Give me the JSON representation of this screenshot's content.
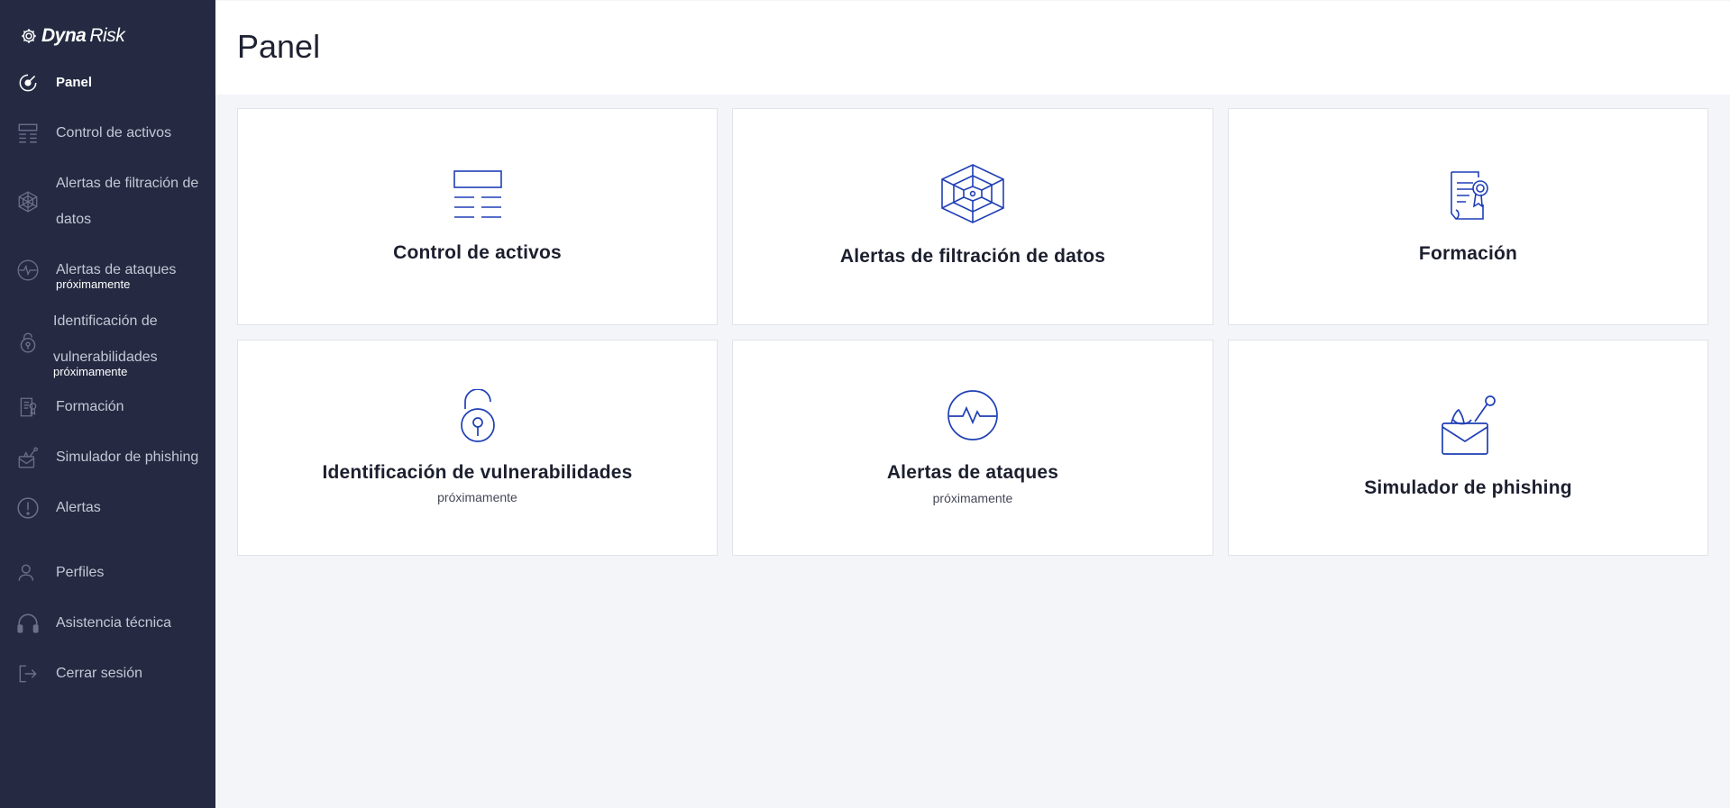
{
  "brand": {
    "part1": "Dyna",
    "part2": "Risk"
  },
  "sidebar": {
    "items": [
      {
        "label": "Panel",
        "icon": "dashboard-icon"
      },
      {
        "label": "Control de activos",
        "icon": "assets-icon"
      },
      {
        "label_line1": "Alertas de filtración de",
        "label_line2": "datos",
        "icon": "web-icon"
      },
      {
        "label": "Alertas de ataques",
        "sub": "próximamente",
        "icon": "pulse-icon"
      },
      {
        "label_line1": "Identificación de",
        "label_line2": "vulnerabilidades",
        "sub": "próximamente",
        "icon": "lock-icon"
      },
      {
        "label": "Formación",
        "icon": "certificate-icon"
      },
      {
        "label": "Simulador de phishing",
        "icon": "phishing-icon"
      },
      {
        "label": "Alertas",
        "icon": "alert-icon"
      },
      {
        "label": "Perfiles",
        "icon": "user-icon"
      },
      {
        "label": "Asistencia técnica",
        "icon": "headset-icon"
      },
      {
        "label": "Cerrar sesión",
        "icon": "logout-icon"
      }
    ]
  },
  "header": {
    "title": "Panel"
  },
  "cards": [
    {
      "title": "Control de activos",
      "icon": "assets-icon"
    },
    {
      "title": "Alertas de filtración de datos",
      "icon": "web-icon"
    },
    {
      "title": "Formación",
      "icon": "certificate-icon"
    },
    {
      "title": "Identificación de vulnerabilidades",
      "sub": "próximamente",
      "icon": "lock-icon"
    },
    {
      "title": "Alertas de ataques",
      "sub": "próximamente",
      "icon": "pulse-icon"
    },
    {
      "title": "Simulador de phishing",
      "icon": "phishing-icon"
    }
  ],
  "colors": {
    "sidebar_bg": "#252a42",
    "accent": "#1f3fb5",
    "page_bg": "#f4f5f9"
  }
}
